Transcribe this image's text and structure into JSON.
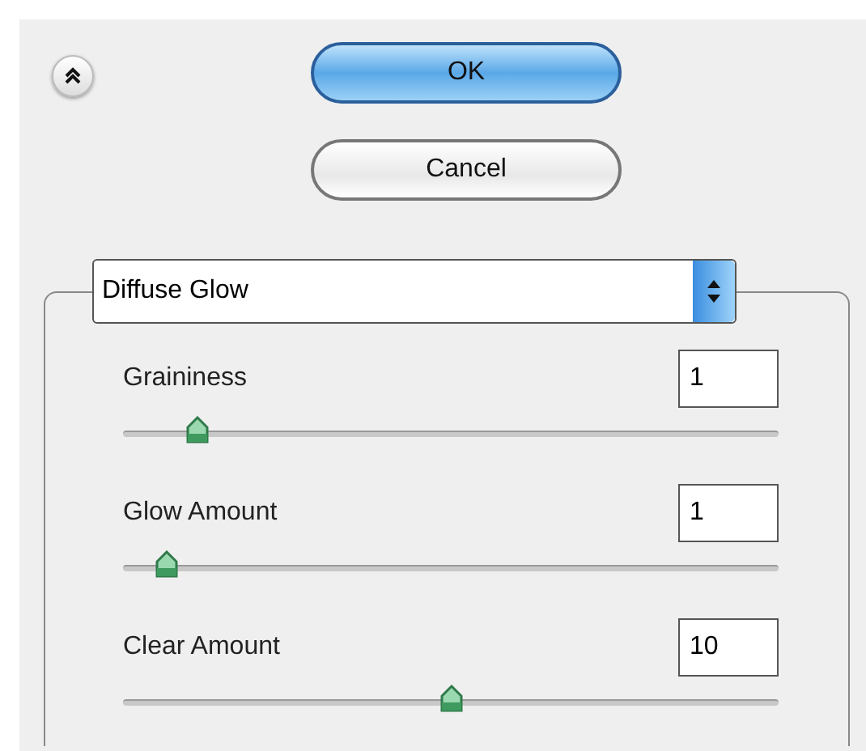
{
  "buttons": [
    {
      "label": "OK",
      "kind": "default"
    },
    {
      "label": "Cancel",
      "kind": "normal"
    }
  ],
  "filter": {
    "value": "Diffuse Glow"
  },
  "sliders": [
    {
      "name": "Graininess",
      "value": "1",
      "level": 0.1
    },
    {
      "name": "Glow Amount",
      "value": "1",
      "level": 0.05
    },
    {
      "name": "Clear Amount",
      "value": "10",
      "level": 0.5
    }
  ]
}
